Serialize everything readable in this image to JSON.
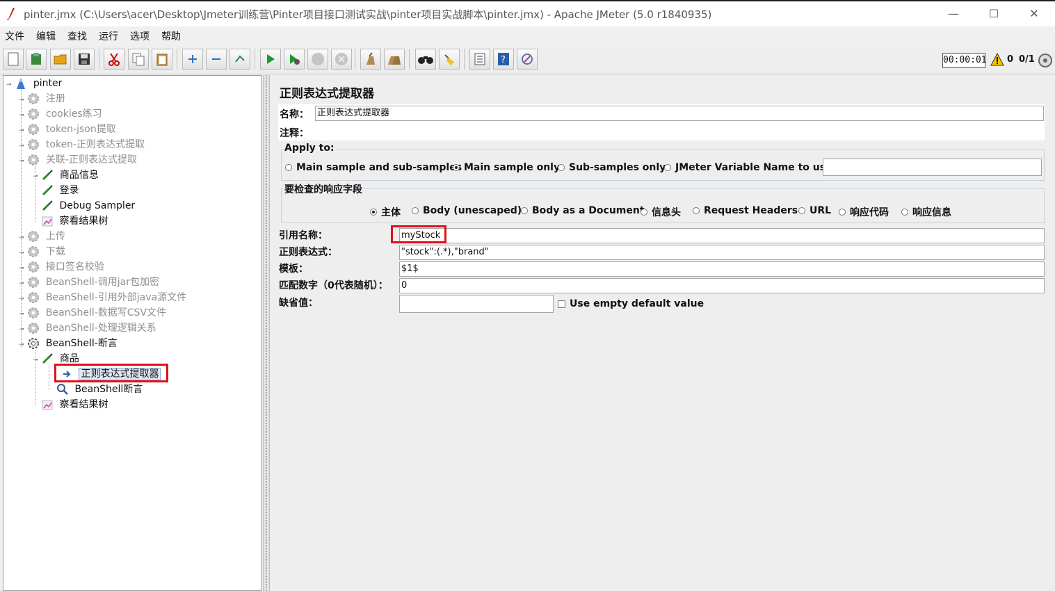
{
  "window": {
    "title": "pinter.jmx (C:\\Users\\acer\\Desktop\\Jmeter训练营\\Pinter项目接口测试实战\\pinter项目实战脚本\\pinter.jmx) - Apache JMeter (5.0 r1840935)",
    "minimize": "—",
    "maximize": "☐",
    "close": "✕"
  },
  "menu": [
    "文件",
    "编辑",
    "查找",
    "运行",
    "选项",
    "帮助"
  ],
  "toolbar": {
    "buttons": [
      "new-icon",
      "templates-icon",
      "open-icon",
      "save-icon",
      "cut-icon",
      "copy-icon",
      "paste-icon",
      "expand-icon",
      "collapse-icon",
      "toggle-icon",
      "start-icon",
      "start-no-pause-icon",
      "stop-icon",
      "shutdown-icon",
      "clear-icon",
      "clear-all-icon",
      "search-icon",
      "reset-search-icon",
      "function-helper-icon",
      "help-icon",
      "remote-icon"
    ],
    "timer": "00:00:01",
    "warnings": "0",
    "threads": "0/1"
  },
  "tree": {
    "root": "pinter",
    "items": [
      {
        "label": "注册",
        "disabled": true
      },
      {
        "label": "cookies练习",
        "disabled": true
      },
      {
        "label": "token-json提取",
        "disabled": true
      },
      {
        "label": "token-正则表达式提取",
        "disabled": true
      },
      {
        "label": "关联-正则表达式提取",
        "disabled": true
      },
      {
        "label": "商品信息",
        "disabled": false
      },
      {
        "label": "登录",
        "disabled": false
      },
      {
        "label": "Debug Sampler",
        "disabled": false
      },
      {
        "label": "察看结果树",
        "disabled": false
      },
      {
        "label": "上传",
        "disabled": true
      },
      {
        "label": "下载",
        "disabled": true
      },
      {
        "label": "接口签名校验",
        "disabled": true
      },
      {
        "label": "BeanShell-调用jar包加密",
        "disabled": true
      },
      {
        "label": "BeanShell-引用外部java源文件",
        "disabled": true
      },
      {
        "label": "BeanShell-数据写CSV文件",
        "disabled": true
      },
      {
        "label": "BeanShell-处理逻辑关系",
        "disabled": true
      },
      {
        "label": "BeanShell-断言",
        "disabled": false
      },
      {
        "label": "商品",
        "disabled": false
      },
      {
        "label": "正则表达式提取器",
        "disabled": false
      },
      {
        "label": "BeanShell断言",
        "disabled": false
      },
      {
        "label": "察看结果树",
        "disabled": false
      }
    ]
  },
  "form": {
    "title": "正则表达式提取器",
    "name_label": "名称：",
    "name_value": "正则表达式提取器",
    "comment_label": "注释：",
    "apply_to": {
      "title": "Apply to:",
      "options": [
        "Main sample and sub-samples",
        "Main sample only",
        "Sub-samples only",
        "JMeter Variable Name to use"
      ],
      "selected": "Main sample only"
    },
    "field_to_check": {
      "title": "要检查的响应字段",
      "options": [
        "主体",
        "Body (unescaped)",
        "Body as a Document",
        "信息头",
        "Request Headers",
        "URL",
        "响应代码",
        "响应信息"
      ],
      "selected": "主体"
    },
    "ref_name_label": "引用名称：",
    "ref_name_value": "myStock",
    "regex_label": "正则表达式：",
    "regex_value": "\"stock\":(.*),\"brand\"",
    "template_label": "模板：",
    "template_value": "$1$",
    "match_no_label": "匹配数字（0代表随机）：",
    "match_no_value": "0",
    "default_label": "缺省值：",
    "default_value": "",
    "use_empty_label": "Use empty default value"
  },
  "colors": {
    "highlight": "#e0101a",
    "selection": "#dfe7f5"
  }
}
